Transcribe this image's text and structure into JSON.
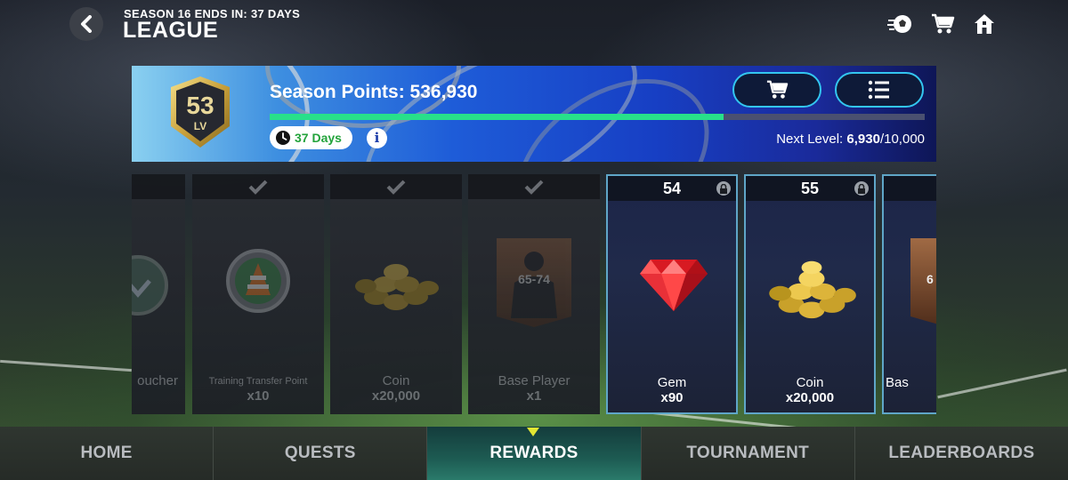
{
  "header": {
    "season_ends": "SEASON 16 ENDS IN: 37 DAYS",
    "title": "LEAGUE",
    "icons": [
      "back-icon",
      "soccer-ball-icon",
      "cart-icon",
      "home-icon"
    ]
  },
  "banner": {
    "level": "53",
    "level_label": "LV",
    "season_points": "Season Points: 536,930",
    "progress_fraction": 0.693,
    "days_left": "37 Days",
    "info_label": "i",
    "next_level_label": "Next Level:",
    "next_level_current": "6,930",
    "next_level_total": "/10,000",
    "buttons": [
      "shop-button",
      "list-button"
    ],
    "accent_color": "#33c6f0",
    "progress_color": "#28e08a"
  },
  "rewards": [
    {
      "name": "oucher",
      "qty": "",
      "state": "claimed",
      "icon": "voucher-icon"
    },
    {
      "name": "Training Transfer Point",
      "qty": "x10",
      "state": "claimed",
      "icon": "training-transfer-icon"
    },
    {
      "name": "Coin",
      "qty": "x20,000",
      "state": "claimed",
      "icon": "coin-pile-icon"
    },
    {
      "name": "Base Player",
      "qty": "x1",
      "state": "claimed",
      "icon": "player-card-icon",
      "card_range": "65-74"
    },
    {
      "level": "54",
      "name": "Gem",
      "qty": "x90",
      "state": "locked",
      "icon": "gem-icon"
    },
    {
      "level": "55",
      "name": "Coin",
      "qty": "x20,000",
      "state": "locked",
      "icon": "coin-pile-icon"
    },
    {
      "name": "Bas",
      "qty": "",
      "state": "locked",
      "icon": "player-card-icon",
      "card_range": "6"
    }
  ],
  "nav": {
    "items": [
      "HOME",
      "QUESTS",
      "REWARDS",
      "TOURNAMENT",
      "LEADERBOARDS"
    ],
    "active": "REWARDS",
    "active_indicator_color": "#e2e633"
  }
}
